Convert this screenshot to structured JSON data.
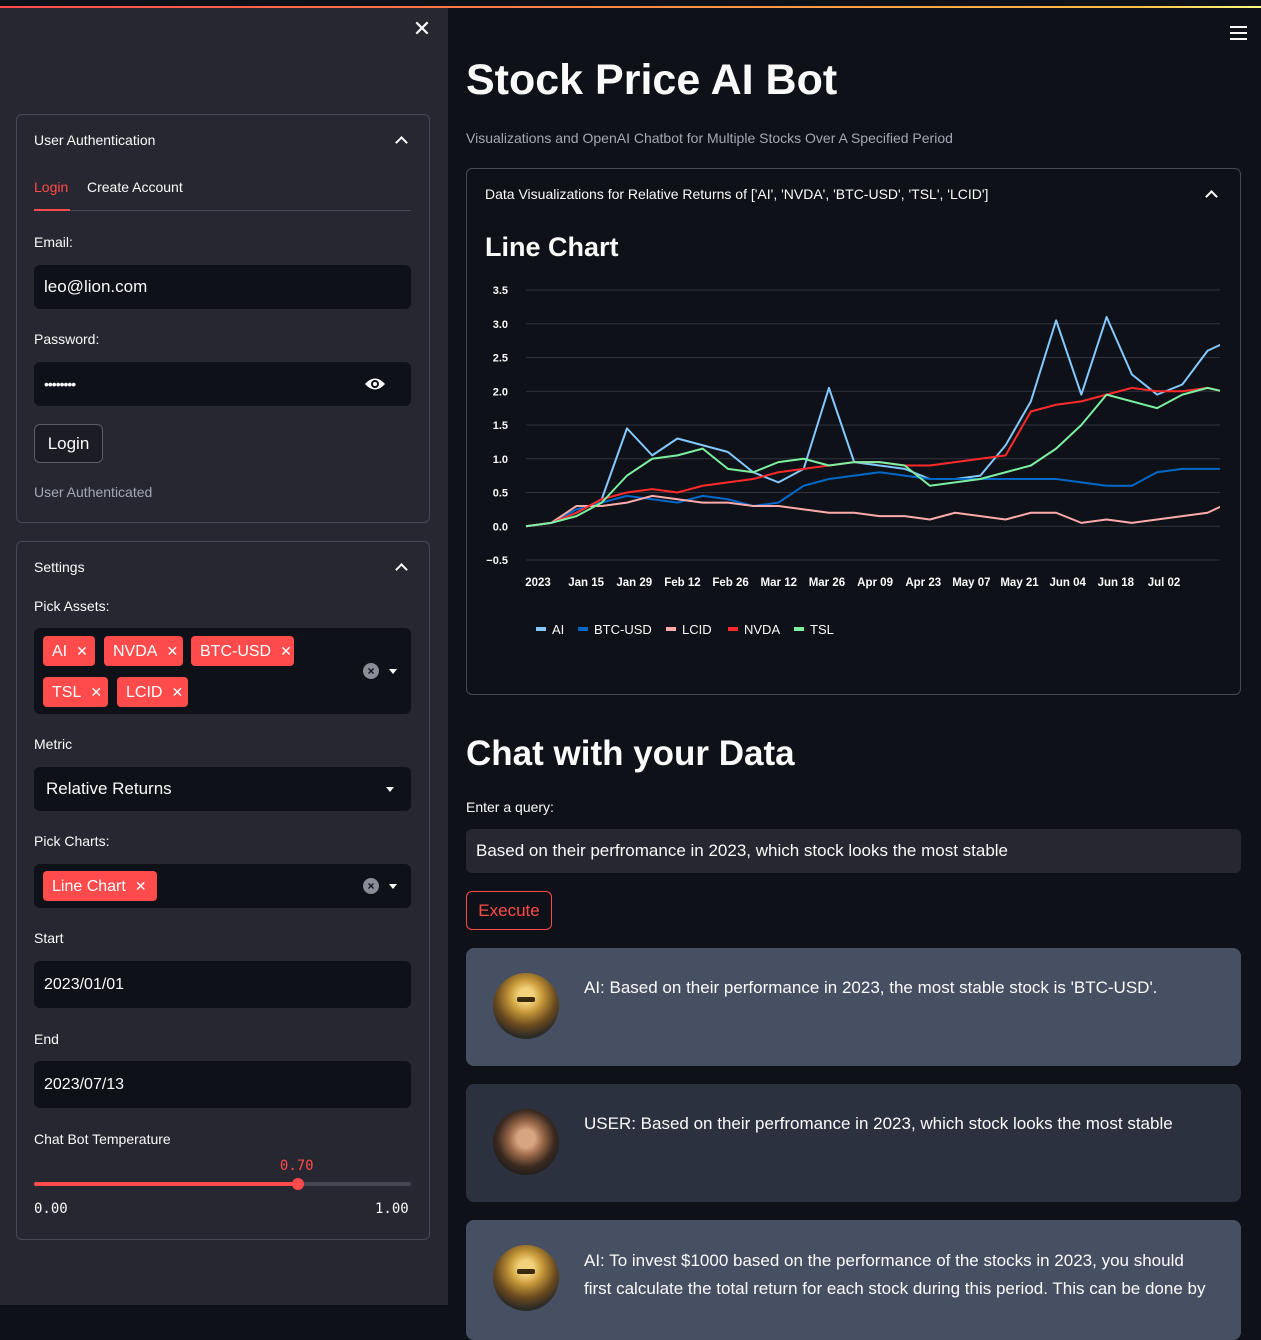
{
  "sidebar": {
    "close_icon": "close-icon",
    "auth": {
      "title": "User Authentication",
      "tabs": [
        "Login",
        "Create Account"
      ],
      "email_label": "Email:",
      "email_value": "leo@lion.com",
      "password_label": "Password:",
      "password_value": "••••••••",
      "login_button": "Login",
      "status": "User Authenticated"
    },
    "settings": {
      "title": "Settings",
      "assets_label": "Pick Assets:",
      "assets": [
        "AI",
        "NVDA",
        "BTC-USD",
        "TSL",
        "LCID"
      ],
      "metric_label": "Metric",
      "metric_value": "Relative Returns",
      "charts_label": "Pick Charts:",
      "charts": [
        "Line Chart"
      ],
      "start_label": "Start",
      "start_value": "2023/01/01",
      "end_label": "End",
      "end_value": "2023/07/13",
      "temp_label": "Chat Bot Temperature",
      "temp_value": "0.70",
      "temp_fraction": 0.7,
      "temp_min": "0.00",
      "temp_max": "1.00"
    }
  },
  "main": {
    "title": "Stock Price AI Bot",
    "subtitle": "Visualizations and OpenAI Chatbot for Multiple Stocks Over A Specified Period",
    "expander_title": "Data Visualizations for Relative Returns of ['AI', 'NVDA', 'BTC-USD', 'TSL', 'LCID']",
    "chart_heading": "Line Chart",
    "chat_heading": "Chat with your Data",
    "query_label": "Enter a query:",
    "query_value": "Based on their perfromance in 2023, which stock looks the most stable",
    "execute_button": "Execute",
    "messages": [
      {
        "role": "AI",
        "text": "AI: Based on their performance in 2023, the most stable stock is 'BTC-USD'."
      },
      {
        "role": "USER",
        "text": "USER: Based on their perfromance in 2023, which stock looks the most stable"
      },
      {
        "role": "AI",
        "text": "AI: To invest $1000 based on the performance of the stocks in 2023, you should first calculate the total return for each stock during this period. This can be done by"
      }
    ]
  },
  "colors": {
    "accent": "#ff4b4b",
    "AI": "#83c9ff",
    "BTC-USD": "#0068c9",
    "LCID": "#ffabab",
    "NVDA": "#ff2b2b",
    "TSL": "#7defa1"
  },
  "chart_data": {
    "type": "line",
    "title": "",
    "xlabel": "",
    "ylabel": "",
    "x_tick_labels": [
      "2023",
      "Jan 15",
      "Jan 29",
      "Feb 12",
      "Feb 26",
      "Mar 12",
      "Mar 26",
      "Apr 09",
      "Apr 23",
      "May 07",
      "May 21",
      "Jun 04",
      "Jun 18",
      "Jul 02"
    ],
    "y_ticks": [
      3.5,
      3.0,
      2.5,
      2.0,
      1.5,
      1.0,
      0.5,
      0.0,
      -0.5
    ],
    "y_tick_labels": [
      "3.5",
      "3.0",
      "2.5",
      "2.0",
      "1.5",
      "1.0",
      "0.5",
      "0.0",
      "−0.5"
    ],
    "ylim": [
      -0.5,
      3.5
    ],
    "xlim": [
      "2023-01-01",
      "2023-07-13"
    ],
    "grid": true,
    "legend_position": "bottom",
    "x": [
      "2023-01-01",
      "2023-01-08",
      "2023-01-15",
      "2023-01-22",
      "2023-01-29",
      "2023-02-05",
      "2023-02-12",
      "2023-02-19",
      "2023-02-26",
      "2023-03-05",
      "2023-03-12",
      "2023-03-19",
      "2023-03-26",
      "2023-04-02",
      "2023-04-09",
      "2023-04-16",
      "2023-04-23",
      "2023-04-30",
      "2023-05-07",
      "2023-05-14",
      "2023-05-21",
      "2023-05-28",
      "2023-06-04",
      "2023-06-11",
      "2023-06-18",
      "2023-06-25",
      "2023-07-02",
      "2023-07-09",
      "2023-07-13"
    ],
    "series": [
      {
        "name": "AI",
        "values": [
          0.0,
          0.05,
          0.2,
          0.4,
          1.45,
          1.05,
          1.3,
          1.2,
          1.1,
          0.8,
          0.65,
          0.85,
          2.05,
          0.95,
          0.9,
          0.85,
          0.7,
          0.7,
          0.75,
          1.2,
          1.85,
          3.05,
          1.95,
          3.1,
          2.25,
          1.95,
          2.1,
          2.6,
          2.7
        ]
      },
      {
        "name": "BTC-USD",
        "values": [
          0.0,
          0.05,
          0.25,
          0.35,
          0.45,
          0.4,
          0.35,
          0.45,
          0.4,
          0.3,
          0.35,
          0.6,
          0.7,
          0.75,
          0.8,
          0.75,
          0.7,
          0.7,
          0.7,
          0.7,
          0.7,
          0.7,
          0.65,
          0.6,
          0.6,
          0.8,
          0.85,
          0.85,
          0.85
        ]
      },
      {
        "name": "LCID",
        "values": [
          0.0,
          0.05,
          0.3,
          0.3,
          0.35,
          0.45,
          0.4,
          0.35,
          0.35,
          0.3,
          0.3,
          0.25,
          0.2,
          0.2,
          0.15,
          0.15,
          0.1,
          0.2,
          0.15,
          0.1,
          0.2,
          0.2,
          0.05,
          0.1,
          0.05,
          0.1,
          0.15,
          0.2,
          0.3
        ]
      },
      {
        "name": "NVDA",
        "values": [
          0.0,
          0.05,
          0.2,
          0.4,
          0.5,
          0.55,
          0.5,
          0.6,
          0.65,
          0.7,
          0.8,
          0.85,
          0.9,
          0.95,
          0.95,
          0.9,
          0.9,
          0.95,
          1.0,
          1.05,
          1.7,
          1.8,
          1.85,
          1.95,
          2.05,
          2.0,
          2.0,
          2.05,
          2.0
        ]
      },
      {
        "name": "TSL",
        "values": [
          0.0,
          0.05,
          0.15,
          0.35,
          0.75,
          1.0,
          1.05,
          1.15,
          0.85,
          0.8,
          0.95,
          1.0,
          0.9,
          0.95,
          0.95,
          0.9,
          0.6,
          0.65,
          0.7,
          0.8,
          0.9,
          1.15,
          1.5,
          1.95,
          1.85,
          1.75,
          1.95,
          2.05,
          2.0
        ]
      }
    ]
  }
}
